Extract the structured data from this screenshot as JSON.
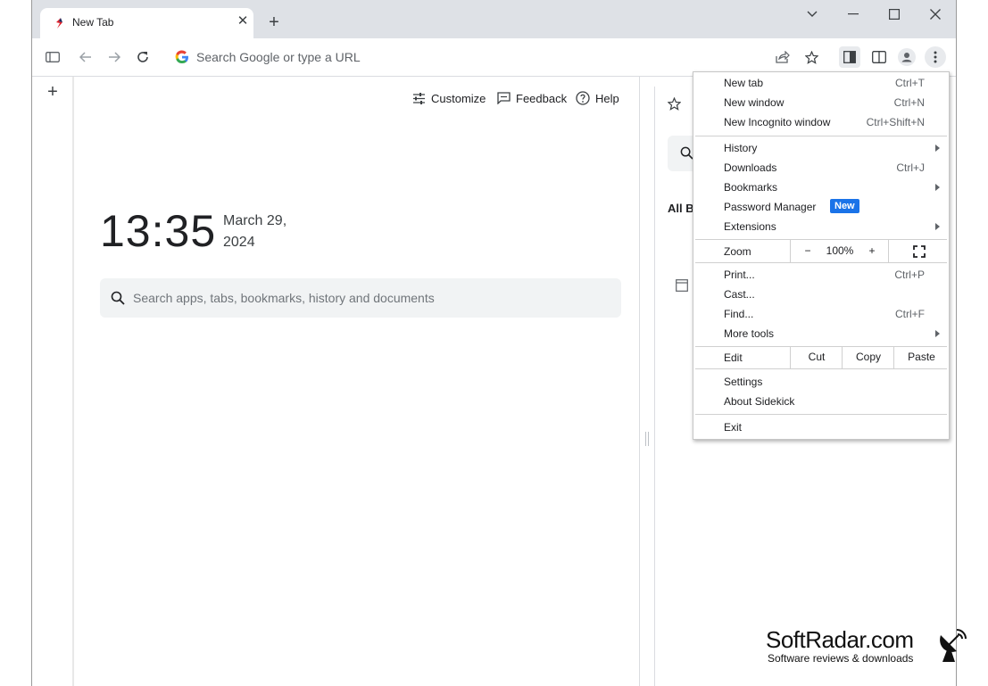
{
  "tab": {
    "title": "New Tab",
    "close_symbol": "✕"
  },
  "newtab_symbol": "+",
  "omnibox": {
    "placeholder": "Search Google or type a URL"
  },
  "rail": {
    "add_symbol": "+"
  },
  "ntp": {
    "customize": "Customize",
    "feedback": "Feedback",
    "help": "Help",
    "time": "13:35",
    "date": "March 29, 2024",
    "search_placeholder": "Search apps, tabs, bookmarks, history and documents"
  },
  "side_panel": {
    "all_bookmarks_partial": "All Bo"
  },
  "menu": {
    "new_tab": {
      "label": "New tab",
      "shortcut": "Ctrl+T"
    },
    "new_window": {
      "label": "New window",
      "shortcut": "Ctrl+N"
    },
    "new_incognito": {
      "label": "New Incognito window",
      "shortcut": "Ctrl+Shift+N"
    },
    "history": {
      "label": "History"
    },
    "downloads": {
      "label": "Downloads",
      "shortcut": "Ctrl+J"
    },
    "bookmarks": {
      "label": "Bookmarks"
    },
    "password_manager": {
      "label": "Password Manager",
      "badge": "New"
    },
    "extensions": {
      "label": "Extensions"
    },
    "zoom": {
      "label": "Zoom",
      "minus": "−",
      "value": "100%",
      "plus": "+"
    },
    "print": {
      "label": "Print...",
      "shortcut": "Ctrl+P"
    },
    "cast": {
      "label": "Cast..."
    },
    "find": {
      "label": "Find...",
      "shortcut": "Ctrl+F"
    },
    "more_tools": {
      "label": "More tools"
    },
    "edit": {
      "label": "Edit",
      "cut": "Cut",
      "copy": "Copy",
      "paste": "Paste"
    },
    "settings": {
      "label": "Settings"
    },
    "about": {
      "label": "About Sidekick"
    },
    "exit": {
      "label": "Exit"
    }
  },
  "watermark": {
    "name": "SoftRadar.com",
    "tagline": "Software reviews & downloads"
  },
  "colors": {
    "accent": "#1a73e8",
    "tabstrip": "#dee1e6",
    "favicon": "#e0202a"
  }
}
